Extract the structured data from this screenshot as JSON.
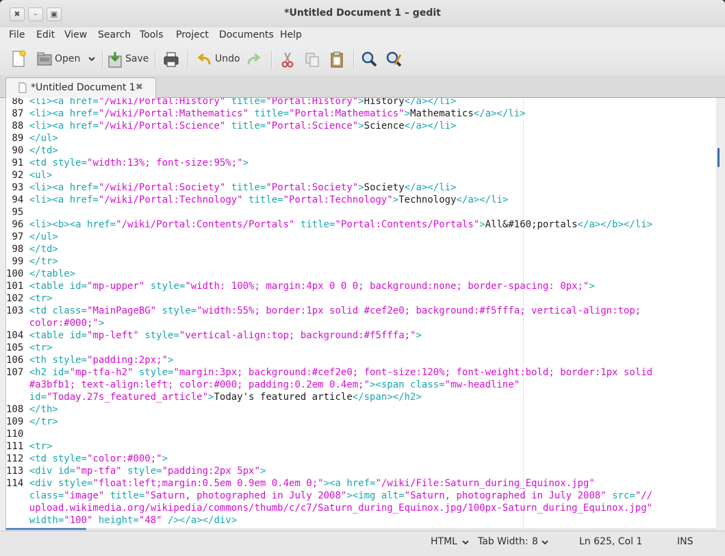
{
  "window": {
    "title": "*Untitled Document 1 – gedit"
  },
  "window_controls": {
    "close": "✖",
    "minimize": "–",
    "maximize": "▣"
  },
  "menubar": [
    "File",
    "Edit",
    "View",
    "Search",
    "Tools",
    "Project",
    "Documents",
    "Help"
  ],
  "toolbar": {
    "new_icon": "new-document-icon",
    "open_label": "Open",
    "open_icon": "open-folder-icon",
    "save_label": "Save",
    "save_icon": "save-icon",
    "print_icon": "print-icon",
    "undo_label": "Undo",
    "undo_icon": "undo-arrow-icon",
    "redo_icon": "redo-arrow-icon",
    "cut_icon": "scissors-icon",
    "copy_icon": "copy-icon",
    "paste_icon": "clipboard-icon",
    "find_icon": "magnifier-icon",
    "replace_icon": "find-replace-icon"
  },
  "tab": {
    "label": "*Untitled Document 1",
    "close": "✖"
  },
  "editor": {
    "colors": {
      "tag": "#19a5ad",
      "attr": "#19a5ad",
      "string": "#d40ed1",
      "text": "#1d1d1d"
    },
    "lines": [
      {
        "num": "86",
        "segs": [
          [
            "t",
            "<li><a "
          ],
          [
            "a",
            "href="
          ],
          [
            "s",
            "\"/wiki/Portal:History\""
          ],
          [
            "a",
            " title="
          ],
          [
            "s",
            "\"Portal:History\""
          ],
          [
            "t",
            ">"
          ],
          [
            "x",
            "History"
          ],
          [
            "t",
            "</a></li>"
          ]
        ]
      },
      {
        "num": "87",
        "segs": [
          [
            "t",
            "<li><a "
          ],
          [
            "a",
            "href="
          ],
          [
            "s",
            "\"/wiki/Portal:Mathematics\""
          ],
          [
            "a",
            " title="
          ],
          [
            "s",
            "\"Portal:Mathematics\""
          ],
          [
            "t",
            ">"
          ],
          [
            "x",
            "Mathematics"
          ],
          [
            "t",
            "</a></li>"
          ]
        ]
      },
      {
        "num": "88",
        "segs": [
          [
            "t",
            "<li><a "
          ],
          [
            "a",
            "href="
          ],
          [
            "s",
            "\"/wiki/Portal:Science\""
          ],
          [
            "a",
            " title="
          ],
          [
            "s",
            "\"Portal:Science\""
          ],
          [
            "t",
            ">"
          ],
          [
            "x",
            "Science"
          ],
          [
            "t",
            "</a></li>"
          ]
        ]
      },
      {
        "num": "89",
        "segs": [
          [
            "t",
            "</ul>"
          ]
        ]
      },
      {
        "num": "90",
        "segs": [
          [
            "t",
            "</td>"
          ]
        ]
      },
      {
        "num": "91",
        "segs": [
          [
            "t",
            "<td "
          ],
          [
            "a",
            "style="
          ],
          [
            "s",
            "\"width:13%; font-size:95%;\""
          ],
          [
            "t",
            ">"
          ]
        ]
      },
      {
        "num": "92",
        "segs": [
          [
            "t",
            "<ul>"
          ]
        ]
      },
      {
        "num": "93",
        "segs": [
          [
            "t",
            "<li><a "
          ],
          [
            "a",
            "href="
          ],
          [
            "s",
            "\"/wiki/Portal:Society\""
          ],
          [
            "a",
            " title="
          ],
          [
            "s",
            "\"Portal:Society\""
          ],
          [
            "t",
            ">"
          ],
          [
            "x",
            "Society"
          ],
          [
            "t",
            "</a></li>"
          ]
        ]
      },
      {
        "num": "94",
        "segs": [
          [
            "t",
            "<li><a "
          ],
          [
            "a",
            "href="
          ],
          [
            "s",
            "\"/wiki/Portal:Technology\""
          ],
          [
            "a",
            " title="
          ],
          [
            "s",
            "\"Portal:Technology\""
          ],
          [
            "t",
            ">"
          ],
          [
            "x",
            "Technology"
          ],
          [
            "t",
            "</a></li>"
          ]
        ]
      },
      {
        "num": "95",
        "segs": []
      },
      {
        "num": "96",
        "segs": [
          [
            "t",
            "<li><b><a "
          ],
          [
            "a",
            "href="
          ],
          [
            "s",
            "\"/wiki/Portal:Contents/Portals\""
          ],
          [
            "a",
            " title="
          ],
          [
            "s",
            "\"Portal:Contents/Portals\""
          ],
          [
            "t",
            ">"
          ],
          [
            "x",
            "All&#160;portals"
          ],
          [
            "t",
            "</a></b></li>"
          ]
        ]
      },
      {
        "num": "97",
        "segs": [
          [
            "t",
            "</ul>"
          ]
        ]
      },
      {
        "num": "98",
        "segs": [
          [
            "t",
            "</td>"
          ]
        ]
      },
      {
        "num": "99",
        "segs": [
          [
            "t",
            "</tr>"
          ]
        ]
      },
      {
        "num": "100",
        "segs": [
          [
            "t",
            "</table>"
          ]
        ]
      },
      {
        "num": "101",
        "segs": [
          [
            "t",
            "<table "
          ],
          [
            "a",
            "id="
          ],
          [
            "s",
            "\"mp-upper\""
          ],
          [
            "a",
            " style="
          ],
          [
            "s",
            "\"width: 100%; margin:4px 0 0 0; background:none; border-spacing: 0px;\""
          ],
          [
            "t",
            ">"
          ]
        ]
      },
      {
        "num": "102",
        "segs": [
          [
            "t",
            "<tr>"
          ]
        ]
      },
      {
        "num": "103",
        "segs": [
          [
            "t",
            "<td "
          ],
          [
            "a",
            "class="
          ],
          [
            "s",
            "\"MainPageBG\""
          ],
          [
            "a",
            " style="
          ],
          [
            "s",
            "\"width:55%; border:1px solid #cef2e0; background:#f5fffa; vertical-align:top;"
          ]
        ]
      },
      {
        "num": "",
        "segs": [
          [
            "s",
            "color:#000;\""
          ],
          [
            "t",
            ">"
          ]
        ]
      },
      {
        "num": "104",
        "segs": [
          [
            "t",
            "<table "
          ],
          [
            "a",
            "id="
          ],
          [
            "s",
            "\"mp-left\""
          ],
          [
            "a",
            " style="
          ],
          [
            "s",
            "\"vertical-align:top; background:#f5fffa;\""
          ],
          [
            "t",
            ">"
          ]
        ]
      },
      {
        "num": "105",
        "segs": [
          [
            "t",
            "<tr>"
          ]
        ]
      },
      {
        "num": "106",
        "segs": [
          [
            "t",
            "<th "
          ],
          [
            "a",
            "style="
          ],
          [
            "s",
            "\"padding:2px;\""
          ],
          [
            "t",
            ">"
          ]
        ]
      },
      {
        "num": "107",
        "segs": [
          [
            "t",
            "<h2 "
          ],
          [
            "a",
            "id="
          ],
          [
            "s",
            "\"mp-tfa-h2\""
          ],
          [
            "a",
            " style="
          ],
          [
            "s",
            "\"margin:3px; background:#cef2e0; font-size:120%; font-weight:bold; border:1px solid"
          ]
        ]
      },
      {
        "num": "",
        "segs": [
          [
            "s",
            "#a3bfb1; text-align:left; color:#000; padding:0.2em 0.4em;\""
          ],
          [
            "t",
            "><span "
          ],
          [
            "a",
            "class="
          ],
          [
            "s",
            "\"mw-headline\""
          ]
        ]
      },
      {
        "num": "",
        "segs": [
          [
            "a",
            "id="
          ],
          [
            "s",
            "\"Today.27s_featured_article\""
          ],
          [
            "t",
            ">"
          ],
          [
            "x",
            "Today's featured article"
          ],
          [
            "t",
            "</span></h2>"
          ]
        ]
      },
      {
        "num": "108",
        "segs": [
          [
            "t",
            "</th>"
          ]
        ]
      },
      {
        "num": "109",
        "segs": [
          [
            "t",
            "</tr>"
          ]
        ]
      },
      {
        "num": "110",
        "segs": []
      },
      {
        "num": "111",
        "segs": [
          [
            "t",
            "<tr>"
          ]
        ]
      },
      {
        "num": "112",
        "segs": [
          [
            "t",
            "<td "
          ],
          [
            "a",
            "style="
          ],
          [
            "s",
            "\"color:#000;\""
          ],
          [
            "t",
            ">"
          ]
        ]
      },
      {
        "num": "113",
        "segs": [
          [
            "t",
            "<div "
          ],
          [
            "a",
            "id="
          ],
          [
            "s",
            "\"mp-tfa\""
          ],
          [
            "a",
            " style="
          ],
          [
            "s",
            "\"padding:2px 5px\""
          ],
          [
            "t",
            ">"
          ]
        ]
      },
      {
        "num": "114",
        "segs": [
          [
            "t",
            "<div "
          ],
          [
            "a",
            "style="
          ],
          [
            "s",
            "\"float:left;margin:0.5em 0.9em 0.4em 0;\""
          ],
          [
            "t",
            "><a "
          ],
          [
            "a",
            "href="
          ],
          [
            "s",
            "\"/wiki/File:Saturn_during_Equinox.jpg\""
          ]
        ]
      },
      {
        "num": "",
        "segs": [
          [
            "a",
            "class="
          ],
          [
            "s",
            "\"image\""
          ],
          [
            "a",
            " title="
          ],
          [
            "s",
            "\"Saturn, photographed in July 2008\""
          ],
          [
            "t",
            "><img "
          ],
          [
            "a",
            "alt="
          ],
          [
            "s",
            "\"Saturn, photographed in July 2008\""
          ],
          [
            "a",
            " src="
          ],
          [
            "s",
            "\"//"
          ]
        ]
      },
      {
        "num": "",
        "segs": [
          [
            "s",
            "upload.wikimedia.org/wikipedia/commons/thumb/c/c7/Saturn_during_Equinox.jpg/100px-Saturn_during_Equinox.jpg\""
          ]
        ]
      },
      {
        "num": "",
        "segs": [
          [
            "a",
            "width="
          ],
          [
            "s",
            "\"100\""
          ],
          [
            "a",
            " height="
          ],
          [
            "s",
            "\"48\""
          ],
          [
            "t",
            " /></a></div>"
          ]
        ]
      }
    ]
  },
  "statusbar": {
    "language": "HTML",
    "tab_width": "Tab Width:",
    "tab_width_value": "8",
    "position": "Ln 625, Col 1",
    "mode": "INS"
  }
}
